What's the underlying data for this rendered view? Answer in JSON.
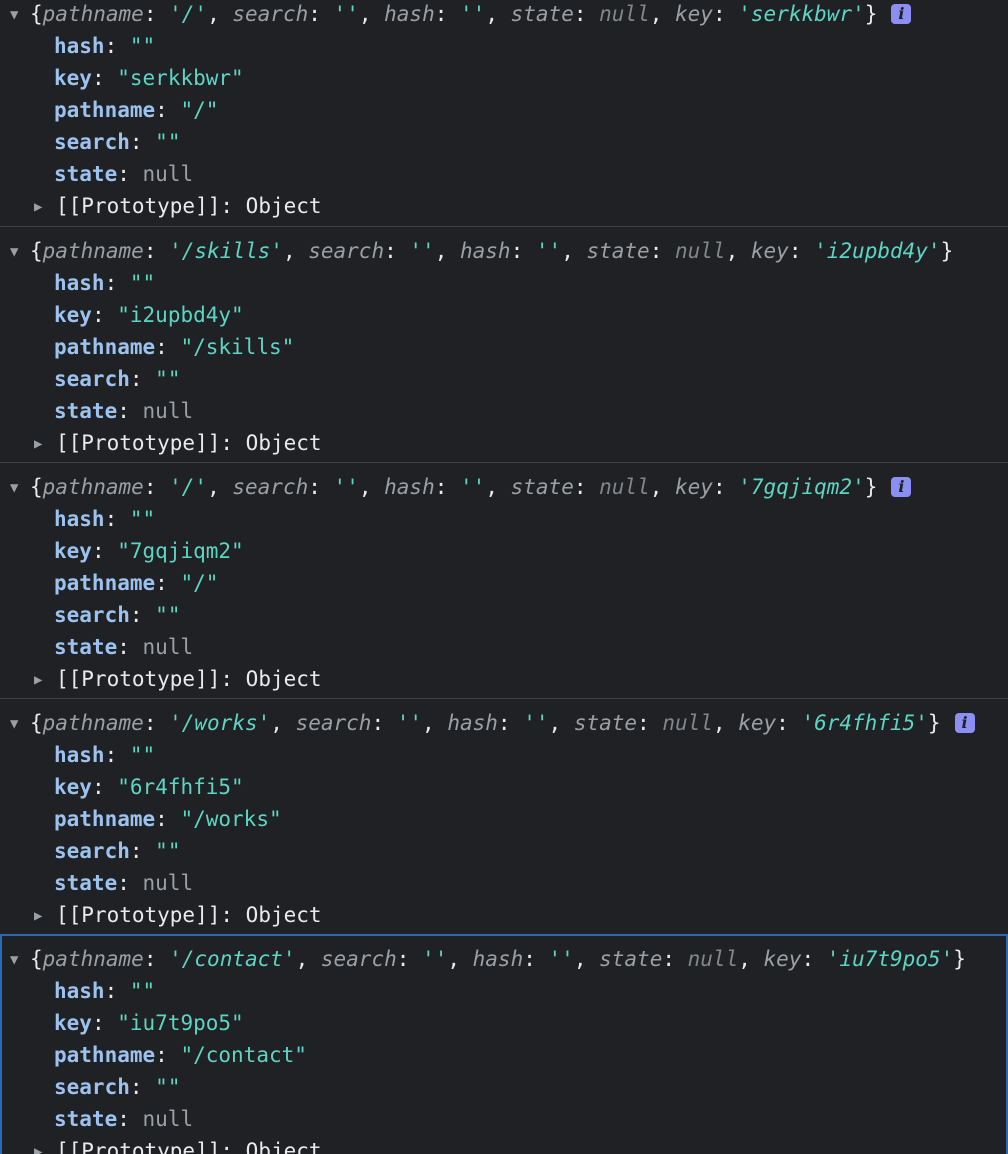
{
  "labels": {
    "hash": "hash",
    "key": "key",
    "pathname": "pathname",
    "search": "search",
    "state": "state",
    "prototype": "[[Prototype]]",
    "prototype_value": "Object",
    "null": "null",
    "info_glyph": "i"
  },
  "entries": [
    {
      "pathname": "/",
      "key": "serkkbwr",
      "hash": "",
      "search": "",
      "state": "null",
      "has_info": true,
      "selected": false
    },
    {
      "pathname": "/skills",
      "key": "i2upbd4y",
      "hash": "",
      "search": "",
      "state": "null",
      "has_info": false,
      "selected": false
    },
    {
      "pathname": "/",
      "key": "7gqjiqm2",
      "hash": "",
      "search": "",
      "state": "null",
      "has_info": true,
      "selected": false
    },
    {
      "pathname": "/works",
      "key": "6r4fhfi5",
      "hash": "",
      "search": "",
      "state": "null",
      "has_info": true,
      "selected": false
    },
    {
      "pathname": "/contact",
      "key": "iu7t9po5",
      "hash": "",
      "search": "",
      "state": "null",
      "has_info": false,
      "selected": true
    }
  ],
  "colors": {
    "background": "#202124",
    "string": "#5cd5c4",
    "property_key": "#9cc3f0",
    "null": "#9aa0a6",
    "info_badge": "#8b8ef2",
    "selection_outline": "#2a6ab3"
  }
}
